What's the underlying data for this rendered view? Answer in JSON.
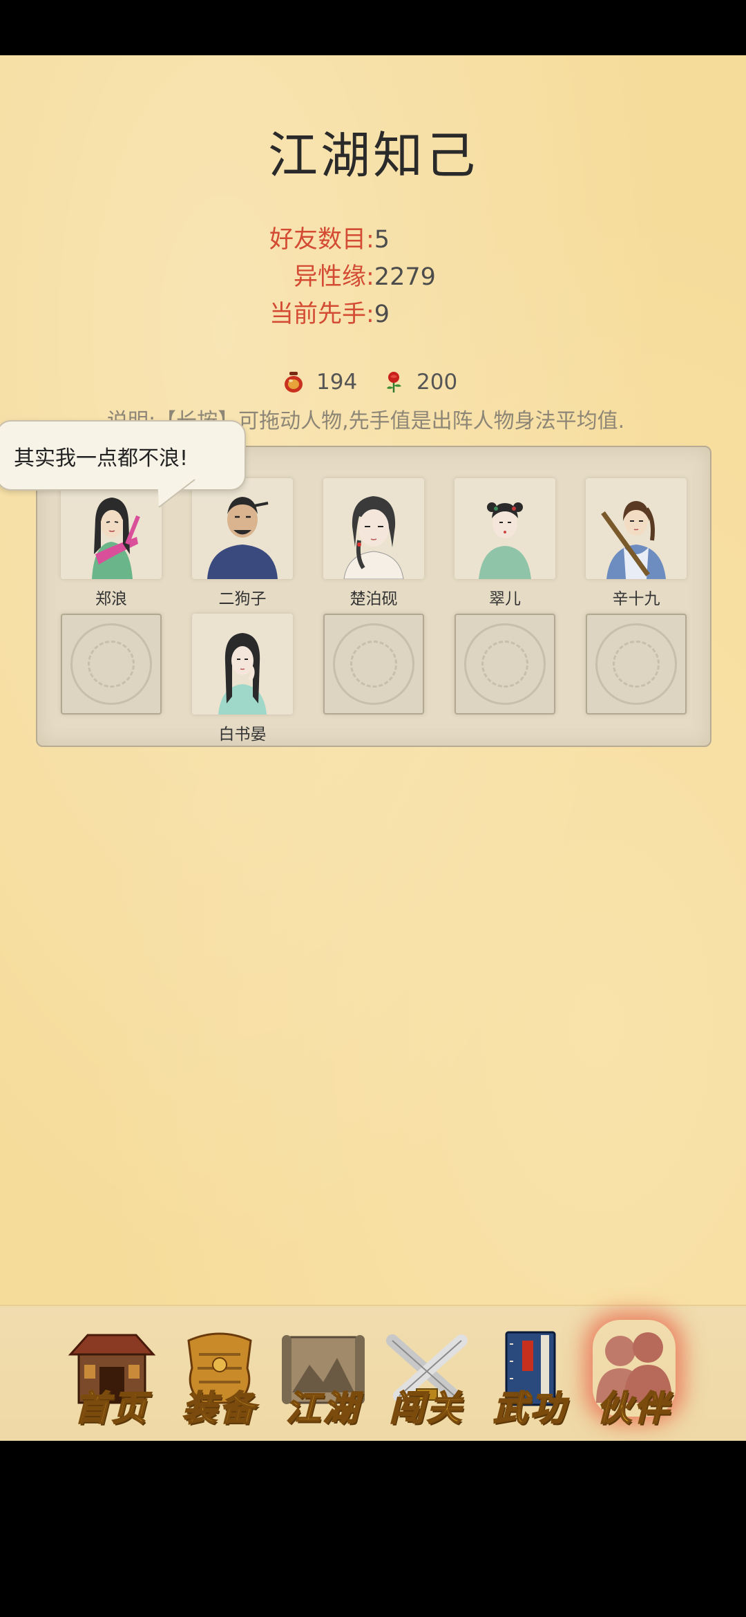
{
  "title": "江湖知己",
  "stats": [
    {
      "label": "好友数目:",
      "value": "5"
    },
    {
      "label": "异性缘:",
      "value": "2279"
    },
    {
      "label": "当前先手:",
      "value": "9"
    }
  ],
  "currency": [
    {
      "icon": "red-pot-icon",
      "value": "194"
    },
    {
      "icon": "rose-icon",
      "value": "200"
    }
  ],
  "note": "说明:【长按】可拖动人物,先手值是出阵人物身法平均值.",
  "bubble": "其实我一点都不浪!",
  "partners": [
    {
      "name": "郑浪",
      "portrait": "portrait-zheng-lang"
    },
    {
      "name": "二狗子",
      "portrait": "portrait-er-gou-zi"
    },
    {
      "name": "楚泊砚",
      "portrait": "portrait-chu-bo-yan"
    },
    {
      "name": "翠儿",
      "portrait": "portrait-cui-er"
    },
    {
      "name": "辛十九",
      "portrait": "portrait-xin-shi-jiu"
    },
    {
      "name": "",
      "portrait": "empty-slot"
    },
    {
      "name": "白书晏",
      "portrait": "portrait-bai-shu-yan"
    },
    {
      "name": "",
      "portrait": "empty-slot"
    },
    {
      "name": "",
      "portrait": "empty-slot"
    },
    {
      "name": "",
      "portrait": "empty-slot"
    }
  ],
  "nav": [
    {
      "label": "首页",
      "icon": "house-icon"
    },
    {
      "label": "装备",
      "icon": "armor-icon"
    },
    {
      "label": "江湖",
      "icon": "scroll-map-icon"
    },
    {
      "label": "闯关",
      "icon": "crossed-swords-icon"
    },
    {
      "label": "武功",
      "icon": "book-icon"
    },
    {
      "label": "伙伴",
      "icon": "partners-icon",
      "active": true
    }
  ]
}
